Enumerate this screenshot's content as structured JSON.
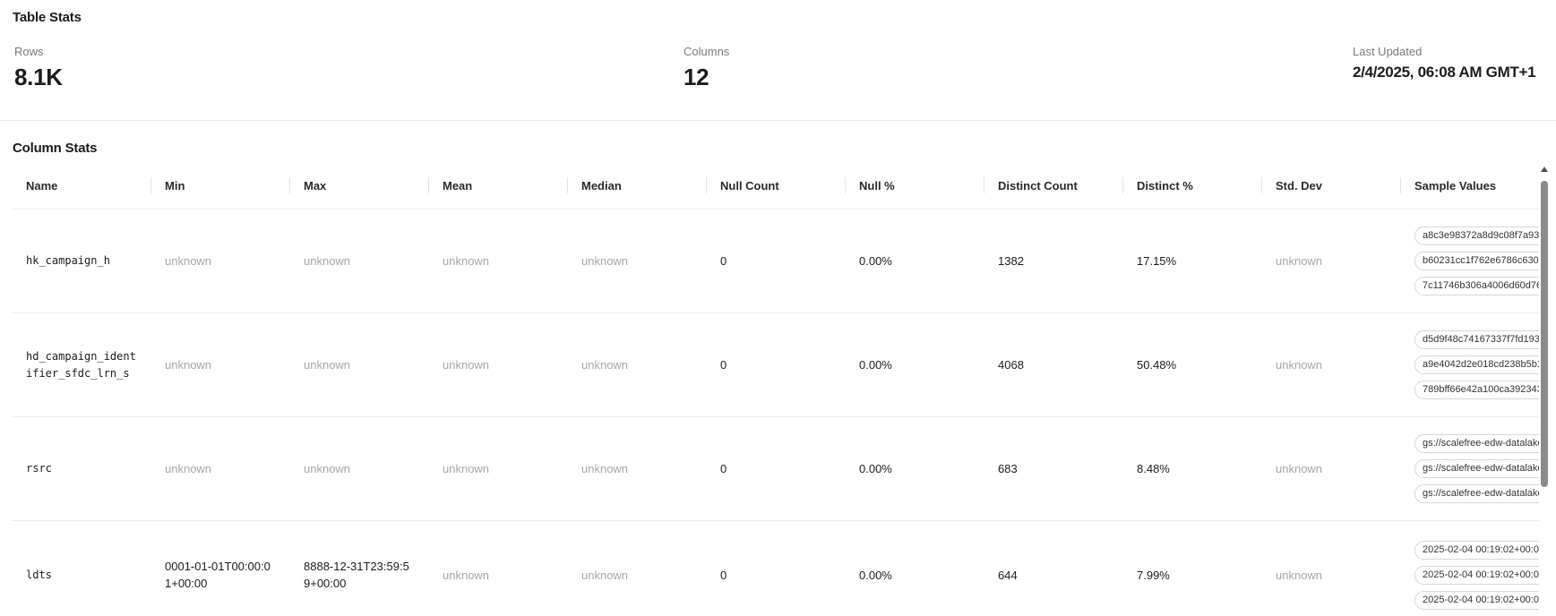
{
  "table_stats": {
    "title": "Table Stats",
    "rows_label": "Rows",
    "rows_value": "8.1K",
    "columns_label": "Columns",
    "columns_value": "12",
    "updated_label": "Last Updated",
    "updated_value": "2/4/2025, 06:08 AM GMT+1"
  },
  "column_stats": {
    "title": "Column Stats",
    "headers": [
      "Name",
      "Min",
      "Max",
      "Mean",
      "Median",
      "Null Count",
      "Null %",
      "Distinct Count",
      "Distinct %",
      "Std. Dev",
      "Sample Values"
    ],
    "rows": [
      {
        "name": "hk_campaign_h",
        "min": "unknown",
        "max": "unknown",
        "mean": "unknown",
        "median": "unknown",
        "null_count": "0",
        "null_pct": "0.00%",
        "distinct_count": "1382",
        "distinct_pct": "17.15%",
        "std_dev": "unknown",
        "samples": [
          "a8c3e98372a8d9c08f7a93",
          "b60231cc1f762e6786c630",
          "7c11746b306a4006d60d76"
        ]
      },
      {
        "name": "hd_campaign_identifier_sfdc_lrn_s",
        "min": "unknown",
        "max": "unknown",
        "mean": "unknown",
        "median": "unknown",
        "null_count": "0",
        "null_pct": "0.00%",
        "distinct_count": "4068",
        "distinct_pct": "50.48%",
        "std_dev": "unknown",
        "samples": [
          "d5d9f48c74167337f7fd193",
          "a9e4042d2e018cd238b5b1",
          "789bff66e42a100ca392343"
        ]
      },
      {
        "name": "rsrc",
        "min": "unknown",
        "max": "unknown",
        "mean": "unknown",
        "median": "unknown",
        "null_count": "0",
        "null_pct": "0.00%",
        "distinct_count": "683",
        "distinct_pct": "8.48%",
        "std_dev": "unknown",
        "samples": [
          "gs://scalefree-edw-datalake",
          "gs://scalefree-edw-datalake",
          "gs://scalefree-edw-datalake"
        ]
      },
      {
        "name": "ldts",
        "min": "0001-01-01T00:00:01+00:00",
        "max": "8888-12-31T23:59:59+00:00",
        "mean": "unknown",
        "median": "unknown",
        "null_count": "0",
        "null_pct": "0.00%",
        "distinct_count": "644",
        "distinct_pct": "7.99%",
        "std_dev": "unknown",
        "samples": [
          "2025-02-04 00:19:02+00:0",
          "2025-02-04 00:19:02+00:0",
          "2025-02-04 00:19:02+00:0"
        ]
      }
    ]
  }
}
